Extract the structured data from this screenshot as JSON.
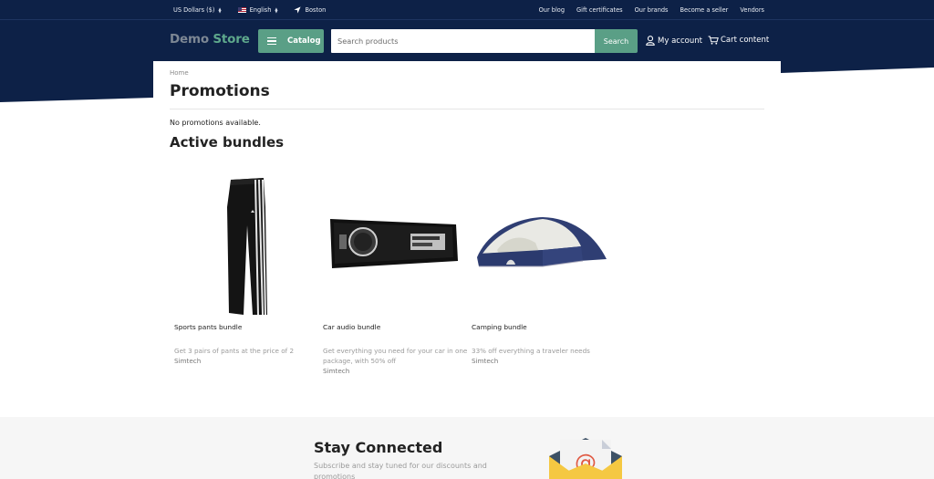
{
  "topbar": {
    "currency": "US Dollars ($)",
    "language": "English",
    "location": "Boston",
    "links": [
      "Our blog",
      "Gift certificates",
      "Our brands",
      "Become a seller",
      "Vendors"
    ]
  },
  "header": {
    "logo_part1": "Demo",
    "logo_part2": "Store",
    "catalog_label": "Catalog",
    "search_placeholder": "Search products",
    "search_button": "Search",
    "account_label": "My account",
    "cart_label": "Cart content"
  },
  "main": {
    "breadcrumb": "Home",
    "title": "Promotions",
    "no_promotions": "No promotions available.",
    "bundles_title": "Active bundles",
    "bundles": [
      {
        "name": "Sports pants bundle",
        "description": "Get 3 pairs of pants at the price of 2",
        "vendor": "Simtech",
        "image": "sports-pants"
      },
      {
        "name": "Car audio bundle",
        "description": "Get everything you need for your car in one package, with 50% off",
        "vendor": "Simtech",
        "image": "car-audio"
      },
      {
        "name": "Camping bundle",
        "description": "33% off everything a traveler needs",
        "vendor": "Simtech",
        "image": "tent"
      }
    ]
  },
  "footer": {
    "title": "Stay Connected",
    "description": "Subscribe and stay tuned for our discounts and promotions"
  },
  "colors": {
    "navy": "#0d2147",
    "accent_green": "#5a9f86",
    "logo_gray": "#7d8794"
  }
}
